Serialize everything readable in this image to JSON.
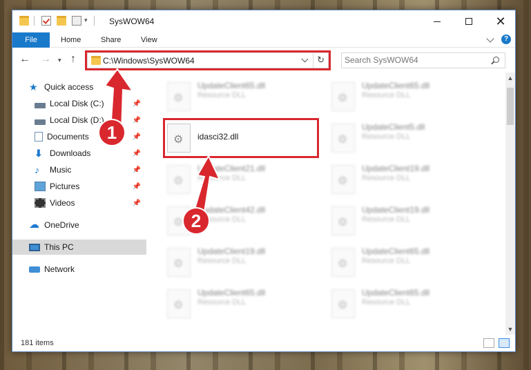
{
  "window": {
    "title": "SysWOW64"
  },
  "ribbon": {
    "tabs": [
      "File",
      "Home",
      "Share",
      "View"
    ],
    "help_label": "?"
  },
  "navbar": {
    "address": "C:\\Windows\\SysWOW64",
    "search_placeholder": "Search SysWOW64"
  },
  "sidebar": {
    "items": [
      {
        "label": "Quick access",
        "icon": "star-icon"
      },
      {
        "label": "Local Disk (C:)",
        "icon": "disk-icon",
        "pinned": true
      },
      {
        "label": "Local Disk (D:)",
        "icon": "disk-icon",
        "pinned": true
      },
      {
        "label": "Documents",
        "icon": "documents-icon",
        "pinned": true
      },
      {
        "label": "Downloads",
        "icon": "downloads-icon",
        "pinned": true
      },
      {
        "label": "Music",
        "icon": "music-icon",
        "pinned": true
      },
      {
        "label": "Pictures",
        "icon": "pictures-icon",
        "pinned": true
      },
      {
        "label": "Videos",
        "icon": "videos-icon",
        "pinned": true
      },
      {
        "label": "OneDrive",
        "icon": "onedrive-icon"
      },
      {
        "label": "This PC",
        "icon": "pc-icon",
        "selected": true
      },
      {
        "label": "Network",
        "icon": "network-icon"
      }
    ]
  },
  "files": {
    "highlighted": {
      "name": "idasci32.dll"
    },
    "others": [
      {
        "name": "UpdateClient65.dll",
        "type": "Resource DLL"
      },
      {
        "name": "UpdateClient65.dll",
        "type": "Resource DLL"
      },
      {
        "name": "UpdateClient5.dll",
        "type": "Resource DLL"
      },
      {
        "name": "UpdateClient21.dll",
        "type": "Resource DLL"
      },
      {
        "name": "UpdateClient19.dll",
        "type": "Resource DLL"
      },
      {
        "name": "UpdateClient42.dll",
        "type": "Resource DLL"
      },
      {
        "name": "UpdateClient19.dll",
        "type": "Resource DLL"
      },
      {
        "name": "UpdateClient19.dll",
        "type": "Resource DLL"
      },
      {
        "name": "UpdateClient65.dll",
        "type": "Resource DLL"
      },
      {
        "name": "UpdateClient65.dll",
        "type": "Resource DLL"
      },
      {
        "name": "UpdateClient65.dll",
        "type": "Resource DLL"
      }
    ]
  },
  "status": {
    "item_count": "181 items"
  },
  "annotations": {
    "step1": "1",
    "step2": "2",
    "highlight_color": "#d9272e"
  },
  "colors": {
    "accent": "#1979ca"
  }
}
